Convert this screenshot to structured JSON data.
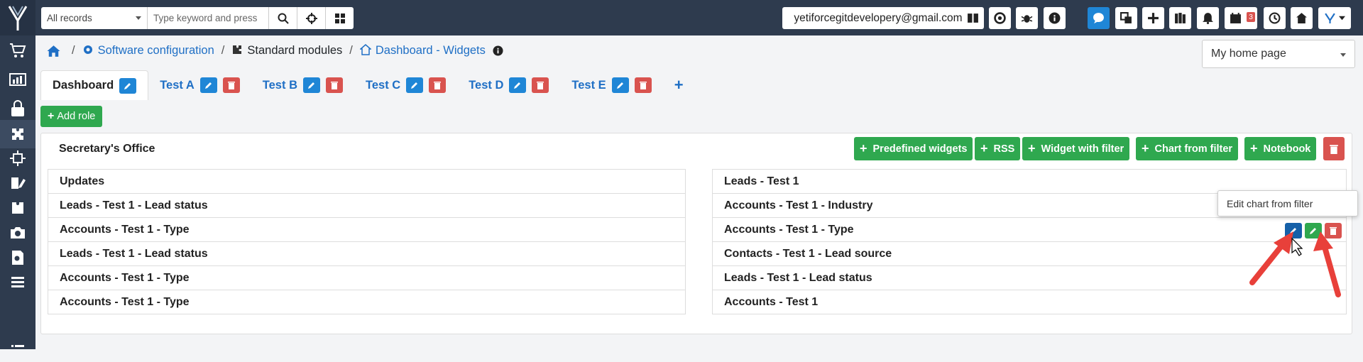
{
  "search": {
    "module_value": "All records",
    "placeholder": "Type keyword and press"
  },
  "header": {
    "user_email": "yetiforcegitdevelopery@gmail.com",
    "calendar_badge": "3"
  },
  "breadcrumb": {
    "item1": "Software configuration",
    "item2": "Standard modules",
    "item3": "Dashboard - Widgets"
  },
  "home_select": {
    "value": "My home page"
  },
  "tabs": [
    {
      "label": "Dashboard"
    },
    {
      "label": "Test A"
    },
    {
      "label": "Test B"
    },
    {
      "label": "Test C"
    },
    {
      "label": "Test D"
    },
    {
      "label": "Test E"
    }
  ],
  "add_role_label": "Add role",
  "panel": {
    "title": "Secretary's Office",
    "buttons": {
      "predefined": "Predefined widgets",
      "rss": "RSS",
      "widget_filter": "Widget with filter",
      "chart_filter": "Chart from filter",
      "notebook": "Notebook"
    },
    "left_widgets": [
      "Updates",
      "Leads - Test 1 - Lead status",
      "Accounts - Test 1 - Type",
      "Leads - Test 1 - Lead status",
      "Accounts - Test 1 - Type",
      "Accounts - Test 1 - Type"
    ],
    "right_widgets": [
      "Leads - Test 1",
      "Accounts - Test 1 - Industry",
      "Accounts - Test 1 - Type",
      "Contacts - Test 1 - Lead source",
      "Leads - Test 1 - Lead status",
      "Accounts - Test 1"
    ]
  },
  "tooltip": "Edit chart from filter",
  "colors": {
    "primary": "#1f86d6",
    "success": "#2fa84f",
    "danger": "#d9534f",
    "navbar": "#2e3b4e"
  }
}
